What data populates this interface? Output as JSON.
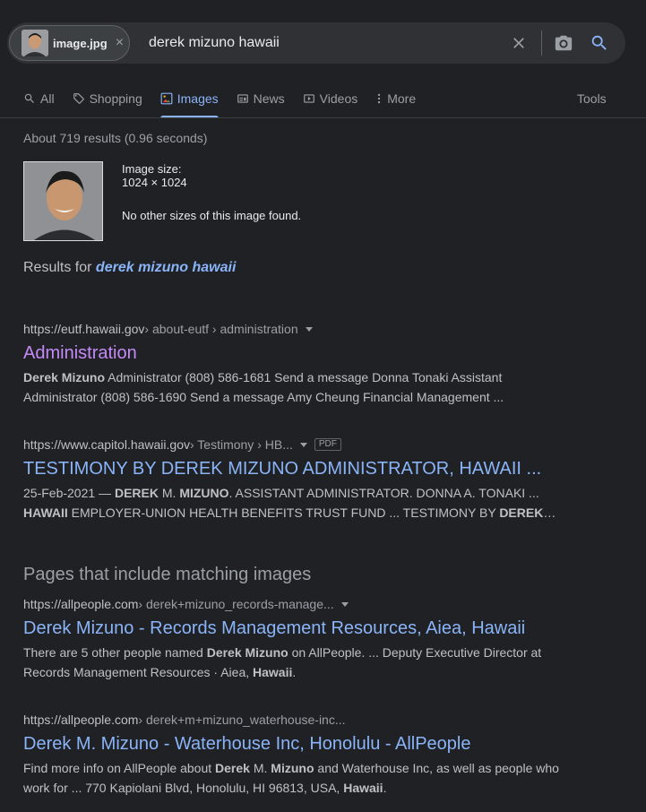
{
  "search": {
    "chip_label": "image.jpg",
    "chip_close": "×",
    "query": "derek mizuno hawaii"
  },
  "tabs": [
    {
      "label": "All",
      "icon": "search-icon"
    },
    {
      "label": "Shopping",
      "icon": "tag-icon"
    },
    {
      "label": "Images",
      "icon": "image-icon",
      "active": true
    },
    {
      "label": "News",
      "icon": "news-icon"
    },
    {
      "label": "Videos",
      "icon": "video-icon"
    },
    {
      "label": "More",
      "icon": "more-vert-icon"
    }
  ],
  "tools_label": "Tools",
  "stats": "About 719 results (0.96 seconds)",
  "image_info": {
    "size_label": "Image size:",
    "size_value": "1024 × 1024",
    "no_other_sizes": "No other sizes of this image found."
  },
  "results_for": {
    "prefix": "Results for",
    "query": "derek mizuno hawaii"
  },
  "results": [
    {
      "domain": "https://eutf.hawaii.gov",
      "path": " › about-eutf › administration",
      "title": "Administration",
      "snippet_line1": {
        "b1": "Derek Mizuno",
        "t1": " Administrator (808) 586-1681 Send a message Donna Tonaki Assistant"
      },
      "snippet_line2": "Administrator (808) 586-1690 Send a message Amy Cheung Financial Management ..."
    },
    {
      "domain": "https://www.capitol.hawaii.gov",
      "path": " › Testimony › HB...",
      "badge": "PDF",
      "title": "TESTIMONY BY DEREK MIZUNO ADMINISTRATOR, HAWAII ...",
      "snippet_line1": {
        "t0": "25-Feb-2021 — ",
        "b1": "DEREK",
        "t1": " M. ",
        "b2": "MIZUNO",
        "t2": ". ASSISTANT ADMINISTRATOR. DONNA A. TONAKI ..."
      },
      "snippet_line2": {
        "b1": "HAWAII",
        "t1": " EMPLOYER-UNION HEALTH BENEFITS TRUST FUND ... TESTIMONY BY ",
        "b2": "DEREK",
        "t2": "…"
      }
    }
  ],
  "matching_section_title": "Pages that include matching images",
  "matching": [
    {
      "domain": "https://allpeople.com",
      "path": " › derek+mizuno_records-manage...",
      "title": "Derek Mizuno - Records Management Resources, Aiea, Hawaii",
      "snippet_line1": {
        "t0": "There are 5 other people named ",
        "b1": "Derek Mizuno",
        "t1": " on AllPeople. ... Deputy Executive Director at"
      },
      "snippet_line2": {
        "t0": "Records Management Resources · Aiea, ",
        "b1": "Hawaii",
        "t1": "."
      }
    },
    {
      "domain": "https://allpeople.com",
      "path": " › derek+m+mizuno_waterhouse-inc...",
      "title": "Derek M. Mizuno - Waterhouse Inc, Honolulu - AllPeople",
      "snippet_line1": {
        "t0": "Find more info on AllPeople about ",
        "b1": "Derek",
        "t1": " M. ",
        "b2": "Mizuno",
        "t2": " and Waterhouse Inc, as well as people who"
      },
      "snippet_line2": {
        "t0": "work for ... 770 Kapiolani Blvd, Honolulu, HI 96813, USA, ",
        "b1": "Hawaii",
        "t1": "."
      }
    }
  ],
  "colors": {
    "background": "#202124",
    "link": "#8ab4f8",
    "visited": "#c58af9",
    "text": "#bdc1c6"
  }
}
